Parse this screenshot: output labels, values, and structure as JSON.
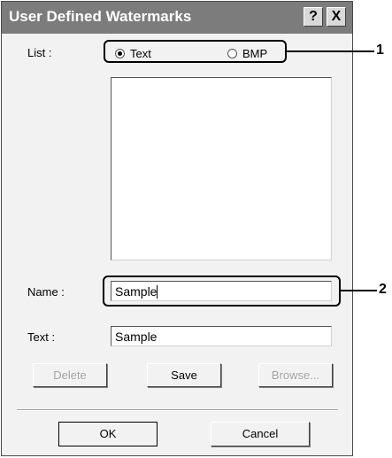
{
  "window": {
    "title": "User Defined Watermarks",
    "help_label": "?",
    "close_label": "X"
  },
  "list": {
    "label": "List :",
    "options": [
      {
        "label": "Text",
        "selected": true
      },
      {
        "label": "BMP",
        "selected": false
      }
    ],
    "items": []
  },
  "name_field": {
    "label": "Name :",
    "value": "Sample"
  },
  "text_field": {
    "label": "Text :",
    "value": "Sample"
  },
  "actions": {
    "delete_label": "Delete",
    "save_label": "Save",
    "browse_label": "Browse..."
  },
  "footer": {
    "ok_label": "OK",
    "cancel_label": "Cancel"
  },
  "callouts": [
    {
      "number": "1"
    },
    {
      "number": "2"
    }
  ],
  "colors": {
    "titlebar": "#7c7c7c",
    "dialog_bg": "#f2f2f2"
  }
}
